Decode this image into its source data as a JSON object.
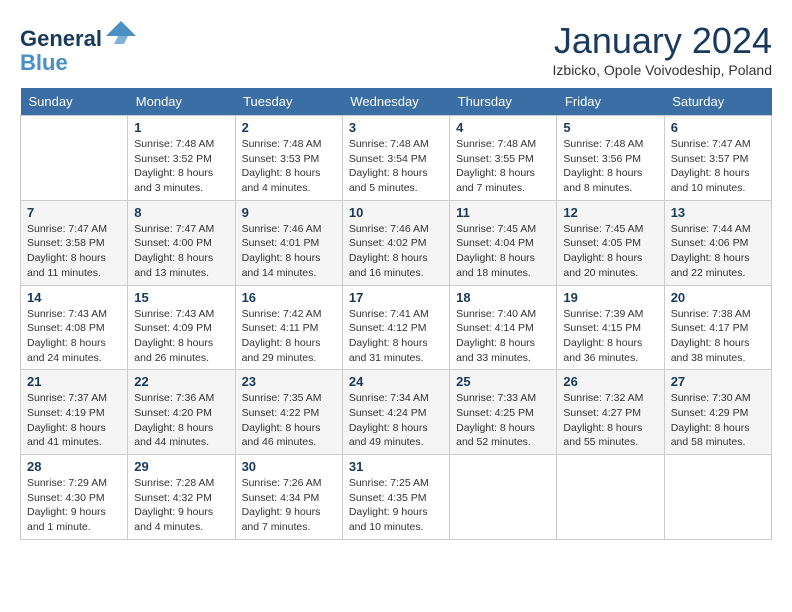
{
  "header": {
    "logo_line1": "General",
    "logo_line2": "Blue",
    "month": "January 2024",
    "location": "Izbicko, Opole Voivodeship, Poland"
  },
  "days_of_week": [
    "Sunday",
    "Monday",
    "Tuesday",
    "Wednesday",
    "Thursday",
    "Friday",
    "Saturday"
  ],
  "weeks": [
    [
      {
        "day": "",
        "info": ""
      },
      {
        "day": "1",
        "info": "Sunrise: 7:48 AM\nSunset: 3:52 PM\nDaylight: 8 hours\nand 3 minutes."
      },
      {
        "day": "2",
        "info": "Sunrise: 7:48 AM\nSunset: 3:53 PM\nDaylight: 8 hours\nand 4 minutes."
      },
      {
        "day": "3",
        "info": "Sunrise: 7:48 AM\nSunset: 3:54 PM\nDaylight: 8 hours\nand 5 minutes."
      },
      {
        "day": "4",
        "info": "Sunrise: 7:48 AM\nSunset: 3:55 PM\nDaylight: 8 hours\nand 7 minutes."
      },
      {
        "day": "5",
        "info": "Sunrise: 7:48 AM\nSunset: 3:56 PM\nDaylight: 8 hours\nand 8 minutes."
      },
      {
        "day": "6",
        "info": "Sunrise: 7:47 AM\nSunset: 3:57 PM\nDaylight: 8 hours\nand 10 minutes."
      }
    ],
    [
      {
        "day": "7",
        "info": "Sunrise: 7:47 AM\nSunset: 3:58 PM\nDaylight: 8 hours\nand 11 minutes."
      },
      {
        "day": "8",
        "info": "Sunrise: 7:47 AM\nSunset: 4:00 PM\nDaylight: 8 hours\nand 13 minutes."
      },
      {
        "day": "9",
        "info": "Sunrise: 7:46 AM\nSunset: 4:01 PM\nDaylight: 8 hours\nand 14 minutes."
      },
      {
        "day": "10",
        "info": "Sunrise: 7:46 AM\nSunset: 4:02 PM\nDaylight: 8 hours\nand 16 minutes."
      },
      {
        "day": "11",
        "info": "Sunrise: 7:45 AM\nSunset: 4:04 PM\nDaylight: 8 hours\nand 18 minutes."
      },
      {
        "day": "12",
        "info": "Sunrise: 7:45 AM\nSunset: 4:05 PM\nDaylight: 8 hours\nand 20 minutes."
      },
      {
        "day": "13",
        "info": "Sunrise: 7:44 AM\nSunset: 4:06 PM\nDaylight: 8 hours\nand 22 minutes."
      }
    ],
    [
      {
        "day": "14",
        "info": "Sunrise: 7:43 AM\nSunset: 4:08 PM\nDaylight: 8 hours\nand 24 minutes."
      },
      {
        "day": "15",
        "info": "Sunrise: 7:43 AM\nSunset: 4:09 PM\nDaylight: 8 hours\nand 26 minutes."
      },
      {
        "day": "16",
        "info": "Sunrise: 7:42 AM\nSunset: 4:11 PM\nDaylight: 8 hours\nand 29 minutes."
      },
      {
        "day": "17",
        "info": "Sunrise: 7:41 AM\nSunset: 4:12 PM\nDaylight: 8 hours\nand 31 minutes."
      },
      {
        "day": "18",
        "info": "Sunrise: 7:40 AM\nSunset: 4:14 PM\nDaylight: 8 hours\nand 33 minutes."
      },
      {
        "day": "19",
        "info": "Sunrise: 7:39 AM\nSunset: 4:15 PM\nDaylight: 8 hours\nand 36 minutes."
      },
      {
        "day": "20",
        "info": "Sunrise: 7:38 AM\nSunset: 4:17 PM\nDaylight: 8 hours\nand 38 minutes."
      }
    ],
    [
      {
        "day": "21",
        "info": "Sunrise: 7:37 AM\nSunset: 4:19 PM\nDaylight: 8 hours\nand 41 minutes."
      },
      {
        "day": "22",
        "info": "Sunrise: 7:36 AM\nSunset: 4:20 PM\nDaylight: 8 hours\nand 44 minutes."
      },
      {
        "day": "23",
        "info": "Sunrise: 7:35 AM\nSunset: 4:22 PM\nDaylight: 8 hours\nand 46 minutes."
      },
      {
        "day": "24",
        "info": "Sunrise: 7:34 AM\nSunset: 4:24 PM\nDaylight: 8 hours\nand 49 minutes."
      },
      {
        "day": "25",
        "info": "Sunrise: 7:33 AM\nSunset: 4:25 PM\nDaylight: 8 hours\nand 52 minutes."
      },
      {
        "day": "26",
        "info": "Sunrise: 7:32 AM\nSunset: 4:27 PM\nDaylight: 8 hours\nand 55 minutes."
      },
      {
        "day": "27",
        "info": "Sunrise: 7:30 AM\nSunset: 4:29 PM\nDaylight: 8 hours\nand 58 minutes."
      }
    ],
    [
      {
        "day": "28",
        "info": "Sunrise: 7:29 AM\nSunset: 4:30 PM\nDaylight: 9 hours\nand 1 minute."
      },
      {
        "day": "29",
        "info": "Sunrise: 7:28 AM\nSunset: 4:32 PM\nDaylight: 9 hours\nand 4 minutes."
      },
      {
        "day": "30",
        "info": "Sunrise: 7:26 AM\nSunset: 4:34 PM\nDaylight: 9 hours\nand 7 minutes."
      },
      {
        "day": "31",
        "info": "Sunrise: 7:25 AM\nSunset: 4:35 PM\nDaylight: 9 hours\nand 10 minutes."
      },
      {
        "day": "",
        "info": ""
      },
      {
        "day": "",
        "info": ""
      },
      {
        "day": "",
        "info": ""
      }
    ]
  ]
}
